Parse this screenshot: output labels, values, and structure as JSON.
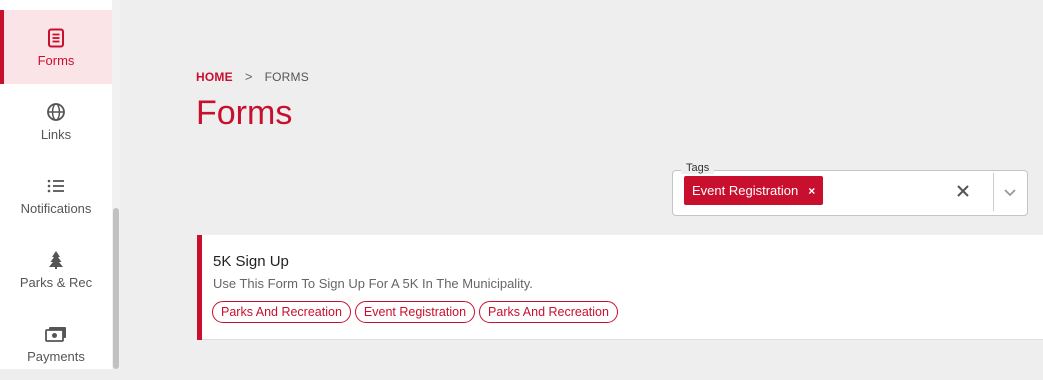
{
  "sidebar": {
    "items": [
      {
        "label": "Forms",
        "icon": "forms-icon",
        "active": true
      },
      {
        "label": "Links",
        "icon": "globe-icon"
      },
      {
        "label": "Notifications",
        "icon": "list-icon"
      },
      {
        "label": "Parks & Rec",
        "icon": "tree-icon"
      },
      {
        "label": "Payments",
        "icon": "money-icon"
      }
    ]
  },
  "breadcrumb": {
    "home": "HOME",
    "separator": ">",
    "current": "FORMS"
  },
  "page_title": "Forms",
  "filter": {
    "legend": "Tags",
    "chips": [
      {
        "label": "Event Registration",
        "remove": "×"
      }
    ]
  },
  "forms": [
    {
      "title": "5K Sign Up",
      "description": "Use This Form To Sign Up For A 5K In The Municipality.",
      "tags": [
        "Parks And Recreation",
        "Event Registration",
        "Parks And Recreation"
      ]
    }
  ],
  "colors": {
    "accent": "#c8102e",
    "background": "#eeeeee"
  }
}
